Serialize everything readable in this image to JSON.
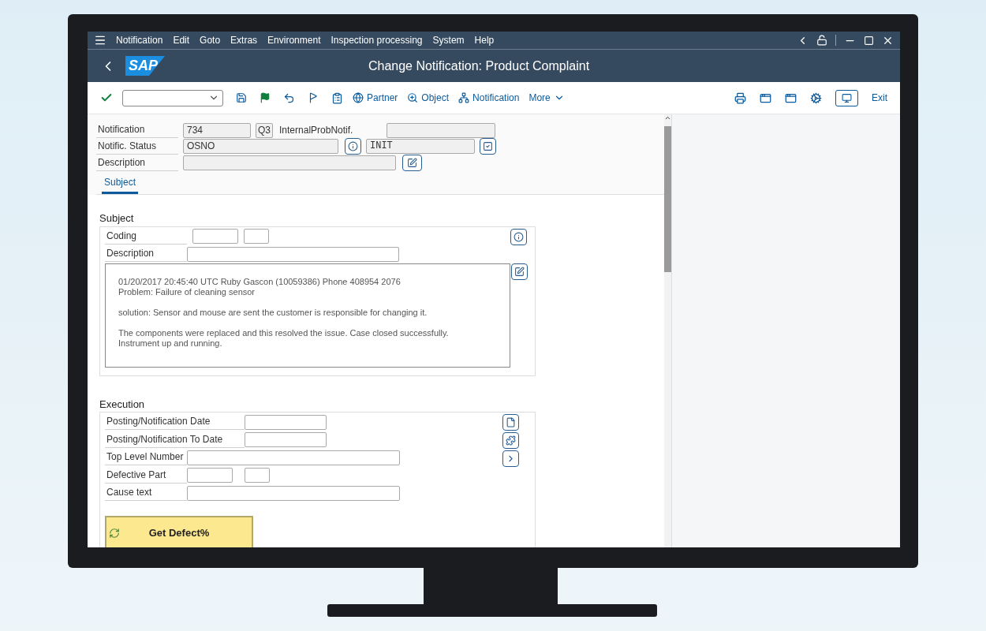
{
  "menu": [
    "Notification",
    "Edit",
    "Goto",
    "Extras",
    "Environment",
    "Inspection processing",
    "System",
    "Help"
  ],
  "title_bar": {
    "logo": "SAP",
    "title": "Change Notification: Product Complaint"
  },
  "toolbar": {
    "buttons": [
      {
        "kind": "globe",
        "label": "Partner"
      },
      {
        "kind": "zoom",
        "label": "Object"
      },
      {
        "kind": "hierarchy",
        "label": "Notification"
      },
      {
        "kind": "more",
        "label": "More"
      }
    ],
    "exit": "Exit"
  },
  "header": {
    "notification": {
      "label": "Notification",
      "value": "734",
      "type": "Q3",
      "internal_label": "InternalProbNotif."
    },
    "status": {
      "label": "Notific. Status",
      "value": "OSNO",
      "system_status": "INIT"
    },
    "description": {
      "label": "Description"
    }
  },
  "tabs": [
    {
      "label": "Subject",
      "selected": true
    }
  ],
  "subject": {
    "title": "Subject",
    "coding_label": "Coding",
    "description_label": "Description",
    "long_text": [
      [
        "01/20/2017 20:45:40 UTC Ruby Gascon (10059386) Phone 408954 2076",
        "Problem: Failure of cleaning sensor"
      ],
      [
        "solution: Sensor and mouse are sent the customer is responsible for changing it."
      ],
      [
        "The components were replaced and this resolved the issue. Case closed successfully.",
        "Instrument up and running."
      ]
    ]
  },
  "execution": {
    "title": "Execution",
    "fields": [
      {
        "label": "Posting/Notification Date",
        "kind": "date"
      },
      {
        "label": "Posting/Notification To Date",
        "kind": "date"
      },
      {
        "label": "Top Level Number",
        "kind": "wide"
      },
      {
        "label": "Defective Part",
        "kind": "pair"
      },
      {
        "label": "Cause text",
        "kind": "wide"
      }
    ],
    "button": "Get Defect%"
  }
}
